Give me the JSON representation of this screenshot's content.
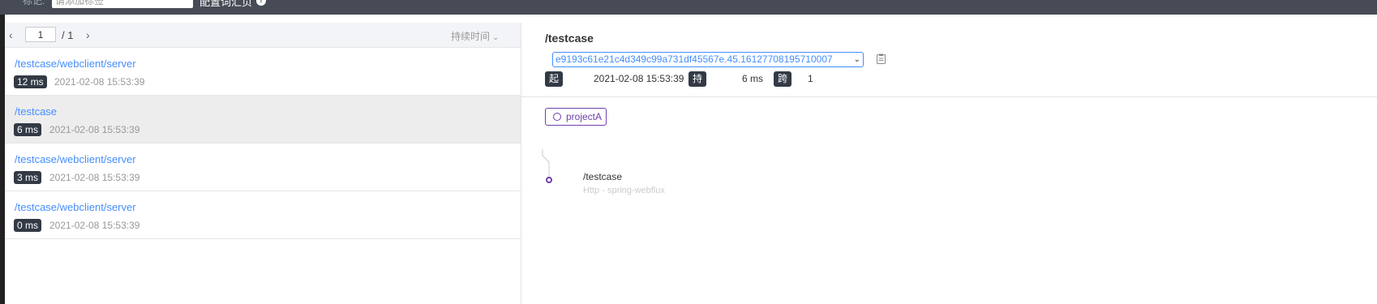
{
  "topbar": {
    "tag_label": "标记:",
    "tag_placeholder": "请添加标签",
    "config_link": "配置词汇页",
    "help_icon": "?"
  },
  "list": {
    "pager": {
      "prev": "‹",
      "page": "1",
      "total": "/ 1",
      "next": "›"
    },
    "sort_label": "持续时间",
    "sort_chevron": "⌄",
    "items": [
      {
        "endpoint": "/testcase/webclient/server",
        "duration": "12 ms",
        "time": "2021-02-08 15:53:39"
      },
      {
        "endpoint": "/testcase",
        "duration": "6 ms",
        "time": "2021-02-08 15:53:39"
      },
      {
        "endpoint": "/testcase/webclient/server",
        "duration": "3 ms",
        "time": "2021-02-08 15:53:39"
      },
      {
        "endpoint": "/testcase/webclient/server",
        "duration": "0 ms",
        "time": "2021-02-08 15:53:39"
      }
    ],
    "active_index": 1
  },
  "detail": {
    "title": "/testcase",
    "trace_id": "e9193c61e21c4d349c99a731df45567e.45.16127708195710007",
    "trace_arrow": "⌄",
    "start_label": "起始点",
    "start_value": "2021-02-08 15:53:39",
    "duration_label": "持续时间",
    "duration_value": "6 ms",
    "span_label": "跨度",
    "span_value": "1",
    "service": "projectA",
    "span": {
      "name": "/testcase",
      "sub": "Http - spring-webflux"
    }
  },
  "colors": {
    "link": "#448dfe",
    "badge": "#333a45",
    "service": "#6e40aa",
    "topbar": "#464b56"
  },
  "icons": [
    "chevron-left-icon",
    "chevron-right-icon",
    "chevron-down-icon",
    "clipboard-icon",
    "help-icon",
    "service-circle-icon"
  ]
}
